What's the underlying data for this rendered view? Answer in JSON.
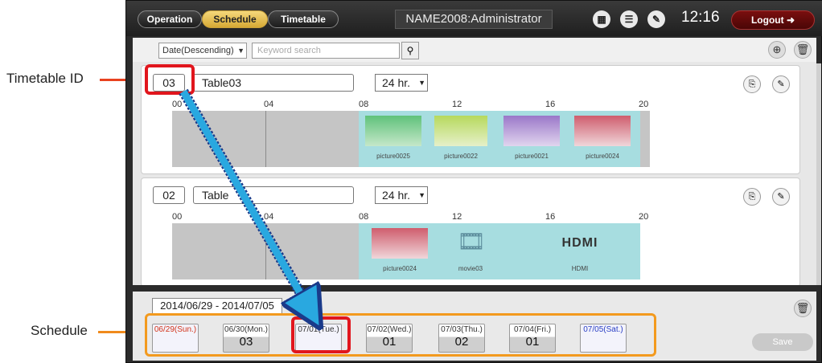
{
  "callouts": {
    "timetable_id": "Timetable ID",
    "schedule": "Schedule"
  },
  "header": {
    "tabs": [
      "Operation",
      "Schedule",
      "Timetable"
    ],
    "active_tab": "Schedule",
    "user": "NAME2008:Administrator",
    "time": "12:16",
    "logout_label": "Logout"
  },
  "toolbar": {
    "sort_value": "Date(Descending)",
    "search_placeholder": "Keyword search"
  },
  "timetables": [
    {
      "id": "03",
      "name": "Table03",
      "range": "24 hr.",
      "hours": [
        "00",
        "04",
        "08",
        "12",
        "16",
        "20"
      ],
      "contents": [
        "picture0025",
        "picture0022",
        "picture0021",
        "picture0024"
      ]
    },
    {
      "id": "02",
      "name": "Table",
      "range": "24 hr.",
      "hours": [
        "00",
        "04",
        "08",
        "12",
        "16",
        "20"
      ],
      "contents": [
        "picture0024",
        "movie03",
        "HDMI"
      ],
      "hdmi_logo": "HDMI"
    }
  ],
  "schedule": {
    "date_range": "2014/06/29 - 2014/07/05",
    "days": [
      {
        "label": "06/29(Sun.)",
        "value": ""
      },
      {
        "label": "06/30(Mon.)",
        "value": "03"
      },
      {
        "label": "07/01(Tue.)",
        "value": ""
      },
      {
        "label": "07/02(Wed.)",
        "value": "01"
      },
      {
        "label": "07/03(Thu.)",
        "value": "02"
      },
      {
        "label": "07/04(Fri.)",
        "value": "01"
      },
      {
        "label": "07/05(Sat.)",
        "value": ""
      }
    ],
    "save_label": "Save"
  },
  "colors": {
    "accent_red": "#e1161d",
    "accent_orange": "#f39a1e",
    "arrow_blue": "#29a8e0",
    "content_cyan": "#a7dde0"
  }
}
